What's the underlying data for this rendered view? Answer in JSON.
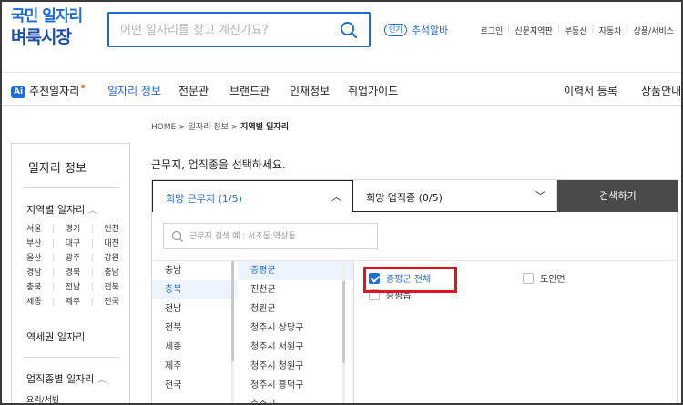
{
  "header": {
    "logo_line1": "국민 일자리",
    "logo_line2": "벼룩시장",
    "search_placeholder": "어떤 일자리를 찾고 계신가요?",
    "popular_badge": "인기",
    "popular_keyword": "추석알바",
    "links": [
      "로그인",
      "신문지역판",
      "부동산",
      "자동차",
      "상품/서비스"
    ]
  },
  "nav": {
    "ai_badge": "Ai",
    "items": [
      "추천일자리",
      "일자리 정보",
      "전문관",
      "브랜드관",
      "인재정보",
      "취업가이드"
    ],
    "right_items": [
      "이력서 등록",
      "상품안내"
    ],
    "accent": "#1e6bd6"
  },
  "breadcrumb": {
    "home": "HOME",
    "sep": ">",
    "level1": "일자리 정보",
    "current": "지역별 일자리"
  },
  "sidebar": {
    "title": "일자리 정보",
    "section1": "지역별 일자리",
    "regions": [
      [
        "서울",
        "경기",
        "인천"
      ],
      [
        "부산",
        "대구",
        "대전"
      ],
      [
        "울산",
        "광주",
        "강원"
      ],
      [
        "경남",
        "경북",
        "충남"
      ],
      [
        "충북",
        "전남",
        "전북"
      ],
      [
        "세종",
        "제주",
        "전국"
      ]
    ],
    "section2": "역세권 일자리",
    "section3": "업직종별 일자리",
    "section3_first": "요리/서빙"
  },
  "main": {
    "prompt": "근무지, 업직종을 선택하세요.",
    "tab_region": "희망 근무지 (1/5)",
    "tab_job": "희망 업직종 (0/5)",
    "search_button": "검색하기",
    "region_search_placeholder": "근무지 검색 예 : 서초동,역삼동",
    "provinces": [
      "충남",
      "충북",
      "전남",
      "전북",
      "세종",
      "제주",
      "전국"
    ],
    "selected_province": "충북",
    "districts": [
      "증평군",
      "진천군",
      "청원군",
      "청주시 상당구",
      "청주시 서원구",
      "청주시 청원구",
      "청주시 흥덕구",
      "충주시"
    ],
    "selected_district": "증평군",
    "options": [
      {
        "label": "증평군 전체",
        "checked": true
      },
      {
        "label": "도안면",
        "checked": false
      },
      {
        "label": "증평읍",
        "checked": false
      }
    ]
  }
}
